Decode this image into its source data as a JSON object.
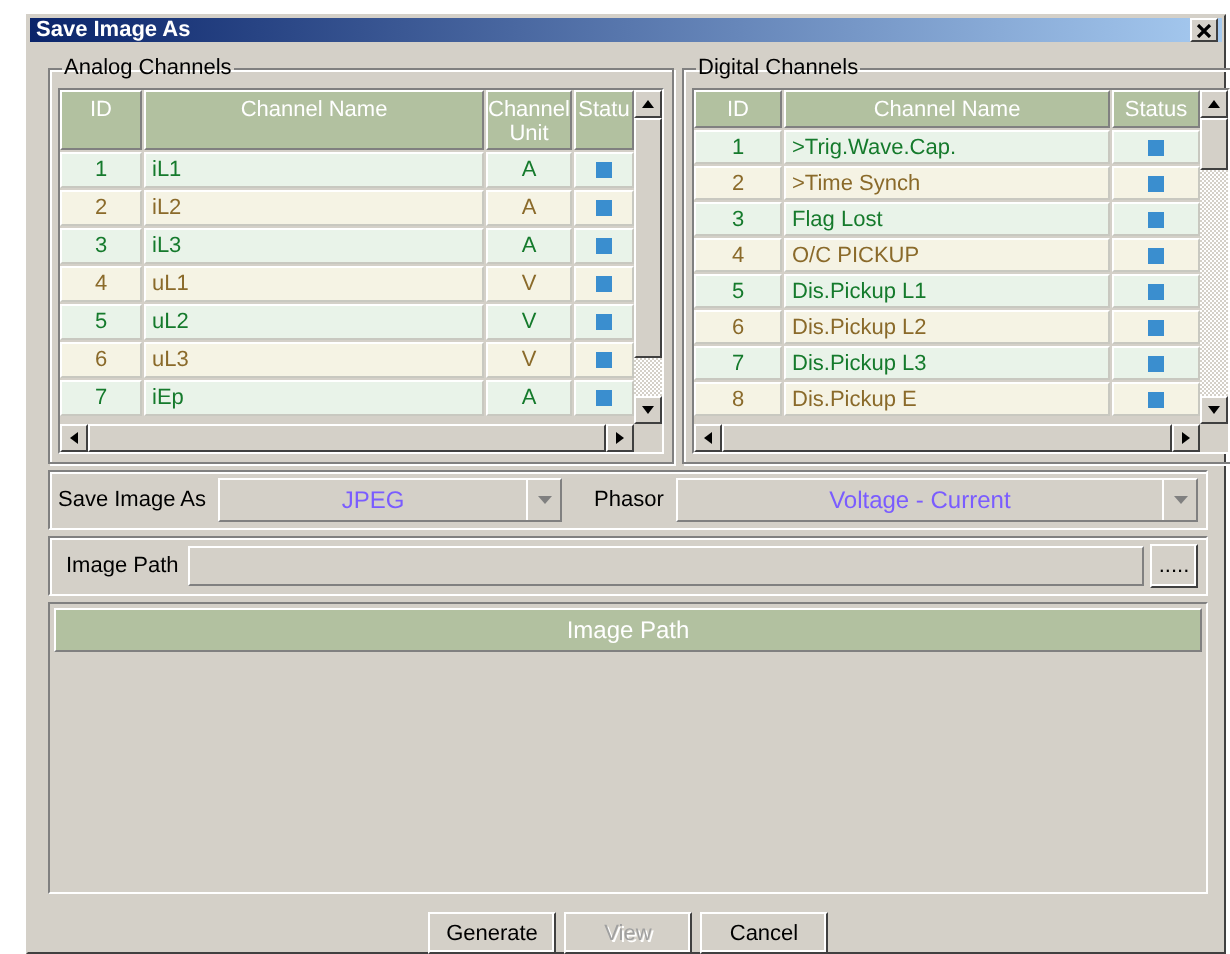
{
  "window": {
    "title": "Save Image As"
  },
  "analog": {
    "title": "Analog Channels",
    "columns": [
      "ID",
      "Channel Name",
      "Channel Unit",
      "Statu"
    ],
    "rows": [
      {
        "id": "1",
        "name": "iL1",
        "unit": "A"
      },
      {
        "id": "2",
        "name": "iL2",
        "unit": "A"
      },
      {
        "id": "3",
        "name": "iL3",
        "unit": "A"
      },
      {
        "id": "4",
        "name": "uL1",
        "unit": "V"
      },
      {
        "id": "5",
        "name": "uL2",
        "unit": "V"
      },
      {
        "id": "6",
        "name": "uL3",
        "unit": "V"
      },
      {
        "id": "7",
        "name": "iEp",
        "unit": "A"
      }
    ]
  },
  "digital": {
    "title": "Digital Channels",
    "columns": [
      "ID",
      "Channel Name",
      "Status"
    ],
    "rows": [
      {
        "id": "1",
        "name": ">Trig.Wave.Cap."
      },
      {
        "id": "2",
        "name": ">Time Synch"
      },
      {
        "id": "3",
        "name": "Flag Lost"
      },
      {
        "id": "4",
        "name": "O/C PICKUP"
      },
      {
        "id": "5",
        "name": "Dis.Pickup L1"
      },
      {
        "id": "6",
        "name": "Dis.Pickup L2"
      },
      {
        "id": "7",
        "name": "Dis.Pickup L3"
      },
      {
        "id": "8",
        "name": "Dis.Pickup E"
      }
    ]
  },
  "format": {
    "label": "Save Image As",
    "value": "JPEG"
  },
  "phasor": {
    "label": "Phasor",
    "value": "Voltage - Current"
  },
  "image_path": {
    "label": "Image Path",
    "browse": ".....",
    "list_header": "Image Path"
  },
  "buttons": [
    {
      "label": "Generate",
      "disabled": false
    },
    {
      "label": "View",
      "disabled": true
    },
    {
      "label": "Cancel",
      "disabled": false
    }
  ]
}
